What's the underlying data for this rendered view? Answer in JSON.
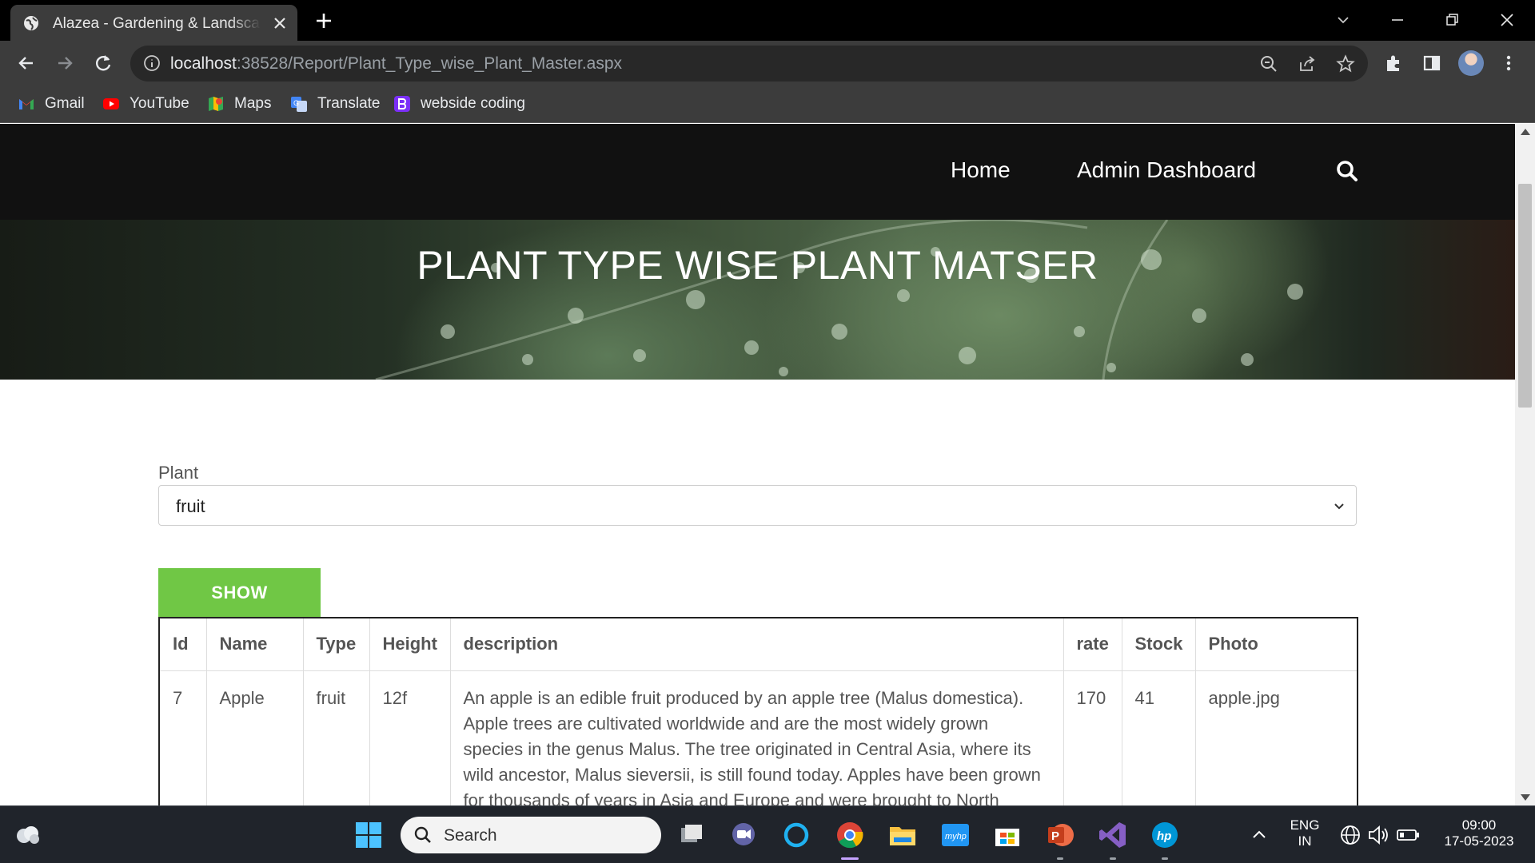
{
  "browser": {
    "tab_title": "Alazea - Gardening & Landscaping",
    "url_host": "localhost",
    "url_rest": ":38528/Report/Plant_Type_wise_Plant_Master.aspx",
    "bookmarks": [
      {
        "label": "Gmail",
        "icon": "gmail-icon"
      },
      {
        "label": "YouTube",
        "icon": "youtube-icon"
      },
      {
        "label": "Maps",
        "icon": "maps-icon"
      },
      {
        "label": "Translate",
        "icon": "translate-icon"
      },
      {
        "label": "webside coding",
        "icon": "bootstrap-icon"
      }
    ]
  },
  "site": {
    "nav": {
      "home": "Home",
      "admin": "Admin Dashboard"
    },
    "hero_title": "PLANT TYPE WISE PLANT MATSER"
  },
  "form": {
    "plant_label": "Plant",
    "plant_selected": "fruit",
    "show_label": "SHOW"
  },
  "table": {
    "headers": [
      "Id",
      "Name",
      "Type",
      "Height",
      "description",
      "rate",
      "Stock",
      "Photo"
    ],
    "rows": [
      {
        "id": "7",
        "name": "Apple",
        "type": "fruit",
        "height": "12f",
        "description": "An apple is an edible fruit produced by an apple tree (Malus domestica). Apple trees are cultivated worldwide and are the most widely grown species in the genus Malus. The tree originated in Central Asia, where its wild ancestor, Malus sieversii, is still found today. Apples have been grown for thousands of years in Asia and Europe and were brought to North America",
        "rate": "170",
        "stock": "41",
        "photo": "apple.jpg"
      }
    ]
  },
  "taskbar": {
    "search_placeholder": "Search",
    "lang_top": "ENG",
    "lang_bottom": "IN",
    "time": "09:00",
    "date": "17-05-2023"
  },
  "colors": {
    "accent_green": "#70c745",
    "nav_bg": "#111111",
    "chrome_dark": "#3c3c3c"
  }
}
